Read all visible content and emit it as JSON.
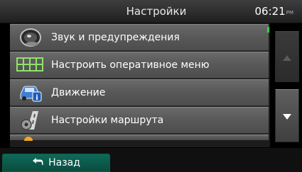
{
  "header": {
    "title": "Настройки",
    "time": "06:21",
    "ampm": "PM"
  },
  "list": {
    "items": [
      {
        "label": "Звук и предупреждения",
        "icon": "speaker-icon"
      },
      {
        "label": "Настроить оперативное меню",
        "icon": "grid-menu-icon"
      },
      {
        "label": "Движение",
        "icon": "traffic-car-icon"
      },
      {
        "label": "Настройки маршрута",
        "icon": "route-settings-icon"
      },
      {
        "label": "",
        "icon": "partial-item-icon"
      }
    ]
  },
  "scroll": {
    "up_icon": "arrow-up-icon",
    "down_icon": "arrow-down-icon"
  },
  "footer": {
    "back_label": "Назад",
    "back_icon": "back-arrow-icon"
  },
  "colors": {
    "accent_green": "#37d13a",
    "back_button": "#0f6a58"
  }
}
